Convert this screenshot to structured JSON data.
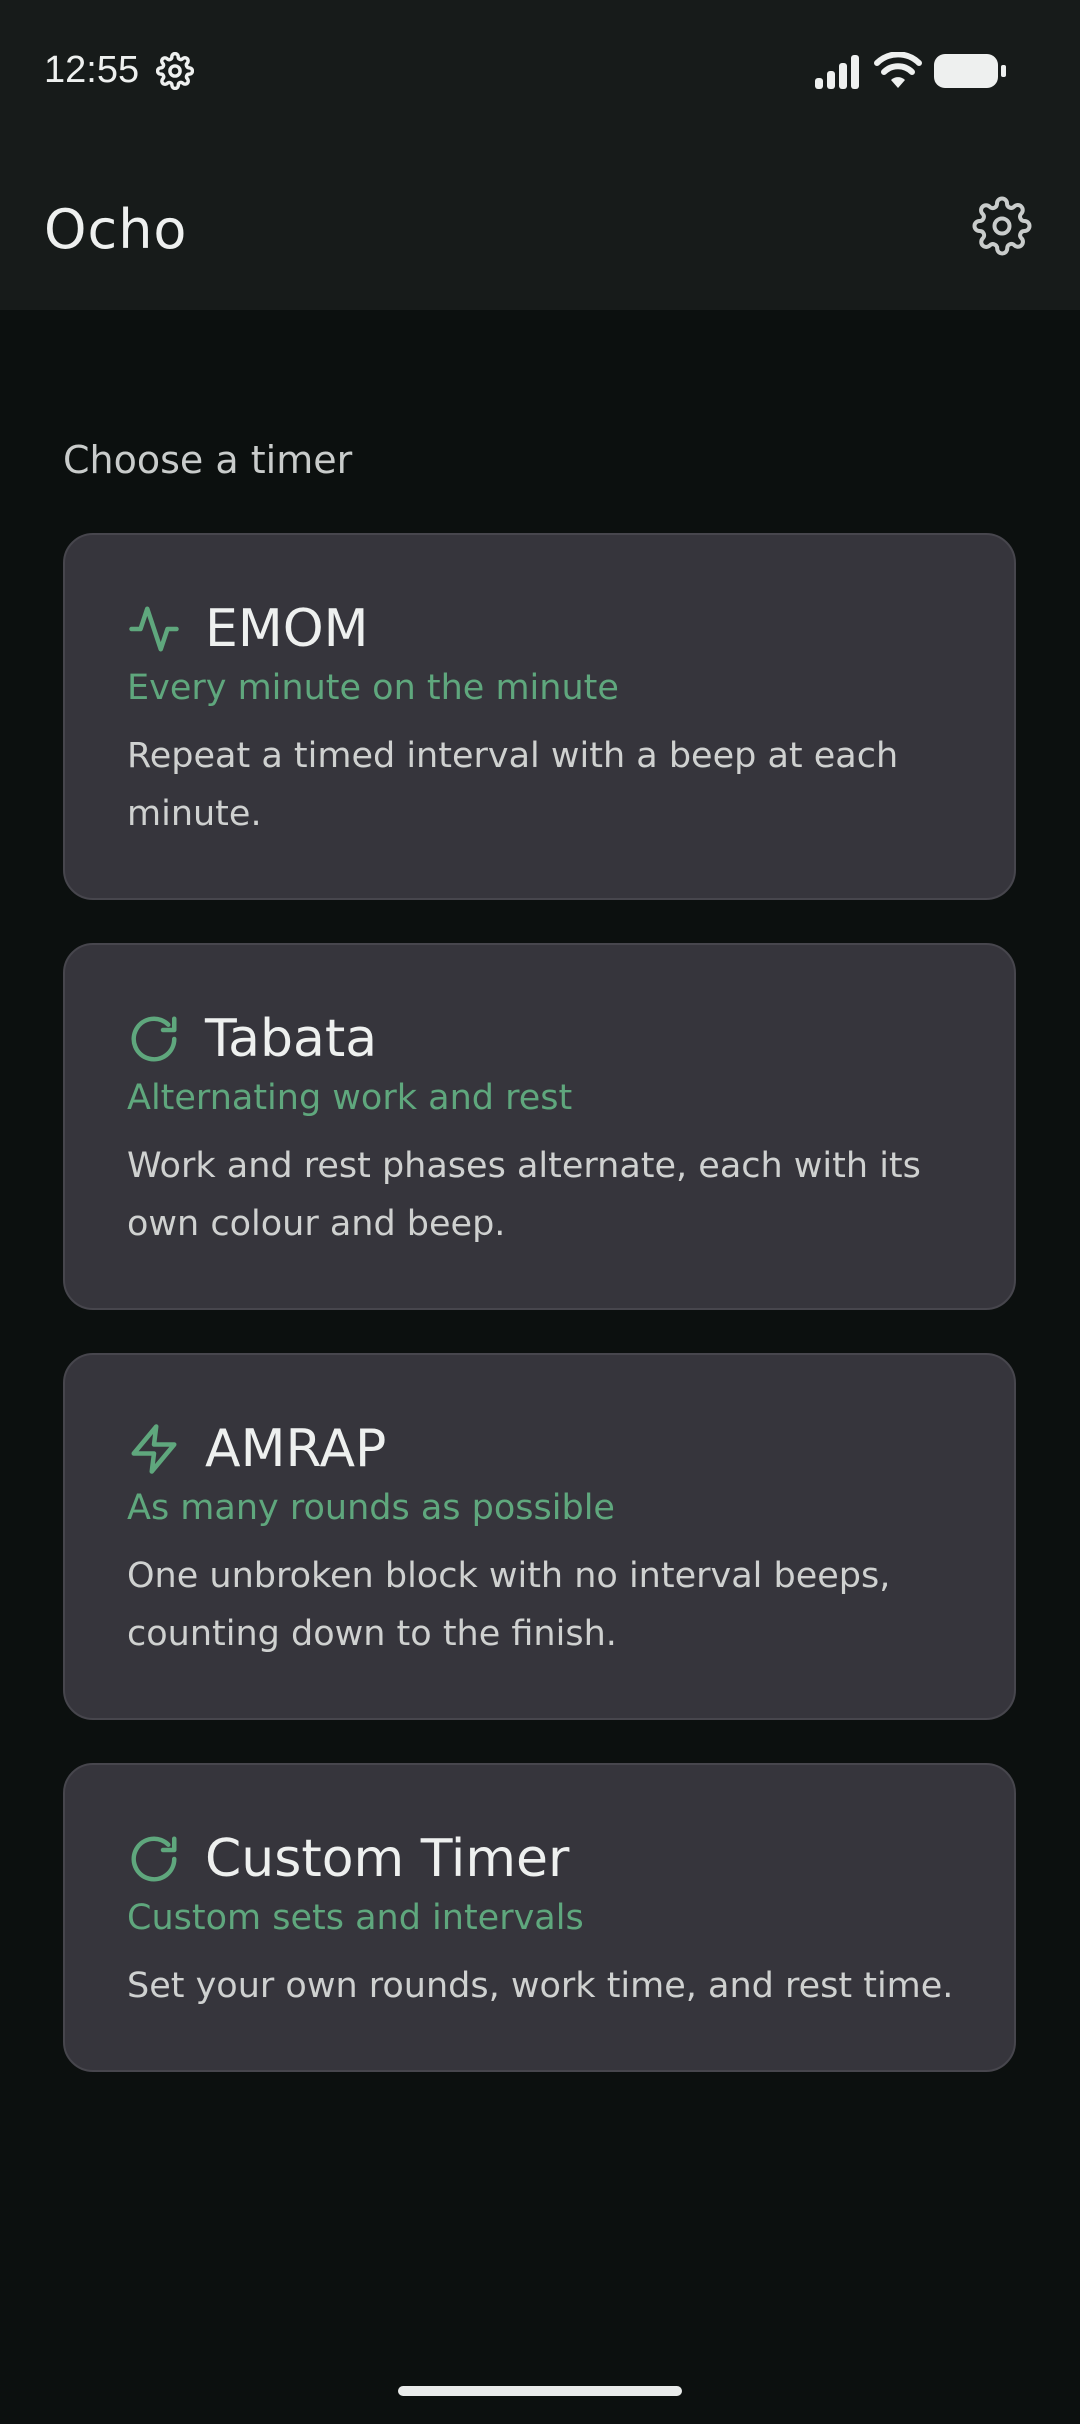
{
  "status_bar": {
    "time": "12:55",
    "settings_icon": "gear-icon",
    "signal_icon": "signal-icon",
    "wifi_icon": "wifi-icon",
    "battery_icon": "battery-icon"
  },
  "app_bar": {
    "title": "Ocho",
    "settings_icon": "gear-icon"
  },
  "main": {
    "section_label": "Choose a timer",
    "cards": [
      {
        "icon": "activity-pulse-icon",
        "title": "EMOM",
        "subtitle": "Every minute on the minute",
        "description": "Repeat a timed interval with a beep at each minute."
      },
      {
        "icon": "refresh-icon",
        "title": "Tabata",
        "subtitle": "Alternating work and rest",
        "description": "Work and rest phases alternate, each with its own colour and beep."
      },
      {
        "icon": "lightning-bolt-icon",
        "title": "AMRAP",
        "subtitle": "As many rounds as possible",
        "description": "One unbroken block with no interval beeps, counting down to the finish."
      },
      {
        "icon": "refresh-icon",
        "title": "Custom Timer",
        "subtitle": "Custom sets and intervals",
        "description": "Set your own rounds, work time, and rest time."
      }
    ]
  },
  "colors": {
    "background": "#0c100f",
    "bar_background": "#171b1a",
    "card_background": "#36353c",
    "accent_green": "#5fa77d",
    "text_primary": "#eef0ef"
  }
}
